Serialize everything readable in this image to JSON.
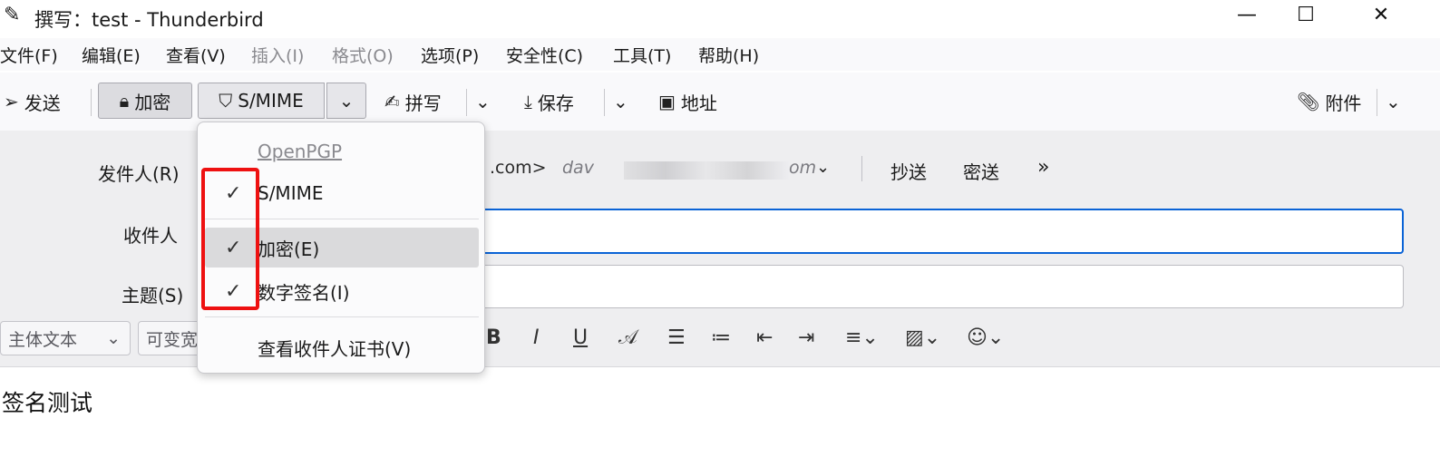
{
  "window": {
    "title": "撰写：test - Thunderbird",
    "min_glyph": "—",
    "max_glyph": "☐",
    "close_glyph": "✕"
  },
  "menubar": {
    "items": [
      {
        "label": "文件(F)",
        "enabled": true
      },
      {
        "label": "编辑(E)",
        "enabled": true
      },
      {
        "label": "查看(V)",
        "enabled": true
      },
      {
        "label": "插入(I)",
        "enabled": false
      },
      {
        "label": "格式(O)",
        "enabled": false
      },
      {
        "label": "选项(P)",
        "enabled": true
      },
      {
        "label": "安全性(C)",
        "enabled": true
      },
      {
        "label": "工具(T)",
        "enabled": true
      },
      {
        "label": "帮助(H)",
        "enabled": true
      }
    ]
  },
  "toolbar": {
    "send_label": "发送",
    "encrypt_label": "加密",
    "smime_label": "S/MIME",
    "spell_label": "拼写",
    "save_label": "保存",
    "address_label": "地址",
    "attach_label": "附件"
  },
  "header": {
    "from_label": "发件人(R)",
    "to_label": "收件人",
    "subject_label": "主题(S)",
    "from_value_visible": ".com>",
    "from_alt_visible_prefix": "dav",
    "from_alt_visible_suffix": "om",
    "cc_label": "抄送",
    "bcc_label": "密送",
    "more_glyph": "»"
  },
  "format": {
    "paragraph_select": "主体文本",
    "font_select": "可变宽"
  },
  "body": {
    "text": "签名测试"
  },
  "popup": {
    "items": [
      {
        "label": "OpenPGP",
        "checked": false,
        "enabled": false
      },
      {
        "label": "S/MIME",
        "checked": true,
        "enabled": true
      },
      {
        "label": "加密(E)",
        "checked": true,
        "enabled": true,
        "hover": true
      },
      {
        "label": "数字签名(I)",
        "checked": true,
        "enabled": true
      },
      {
        "label": "查看收件人证书(V)",
        "checked": false,
        "enabled": true
      }
    ]
  },
  "colors": {
    "focus_border": "#0a63d6",
    "annotation": "#ee1111"
  }
}
